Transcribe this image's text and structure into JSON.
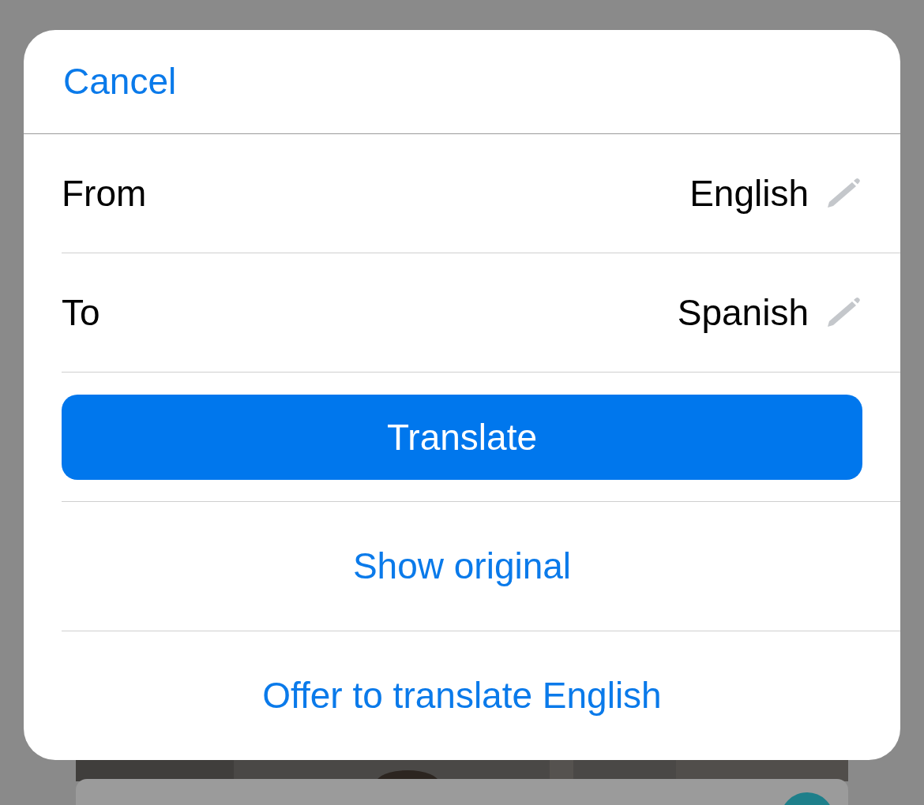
{
  "sheet": {
    "cancel": "Cancel",
    "rows": [
      {
        "label": "From",
        "value": "English"
      },
      {
        "label": "To",
        "value": "Spanish"
      }
    ],
    "primary_button": "Translate",
    "actions": [
      "Show original",
      "Offer to translate English"
    ]
  }
}
